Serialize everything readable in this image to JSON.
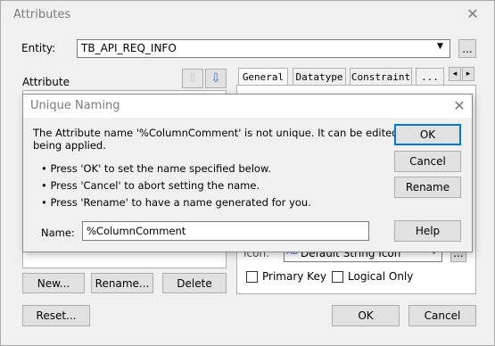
{
  "window": {
    "title": "Attributes",
    "close_glyph": "✕"
  },
  "entity": {
    "label": "Entity:",
    "value": "TB_API_REQ_INFO",
    "more_label": "..."
  },
  "attribute": {
    "label": "Attribute",
    "up_icon": "arrow-up-icon",
    "down_icon": "arrow-down-icon"
  },
  "tabs": [
    {
      "label": "General"
    },
    {
      "label": "Datatype"
    },
    {
      "label": "Constraint"
    },
    {
      "label": "..."
    }
  ],
  "tab_scroll": {
    "left": "◂",
    "right": "▸"
  },
  "icon_row": {
    "label": "Icon:",
    "value": "Default String Icon",
    "more_label": "..."
  },
  "checkboxes": {
    "primary_key": "Primary Key",
    "logical_only": "Logical Only"
  },
  "attr_buttons": {
    "new": "New...",
    "rename": "Rename...",
    "delete": "Delete"
  },
  "bottom_buttons": {
    "reset": "Reset...",
    "ok": "OK",
    "cancel": "Cancel"
  },
  "modal": {
    "title": "Unique Naming",
    "close_glyph": "✕",
    "message_line1": "The Attribute name '%ColumnComment' is not unique.  It can be edited before",
    "message_line2": "being applied.",
    "bullets": [
      "• Press 'OK' to set the name specified below.",
      "• Press 'Cancel' to abort setting the name.",
      "• Press 'Rename' to have a name generated for you."
    ],
    "name_label": "Name:",
    "name_value": "%ColumnComment",
    "buttons": {
      "ok": "OK",
      "cancel": "Cancel",
      "rename": "Rename",
      "help": "Help"
    }
  }
}
